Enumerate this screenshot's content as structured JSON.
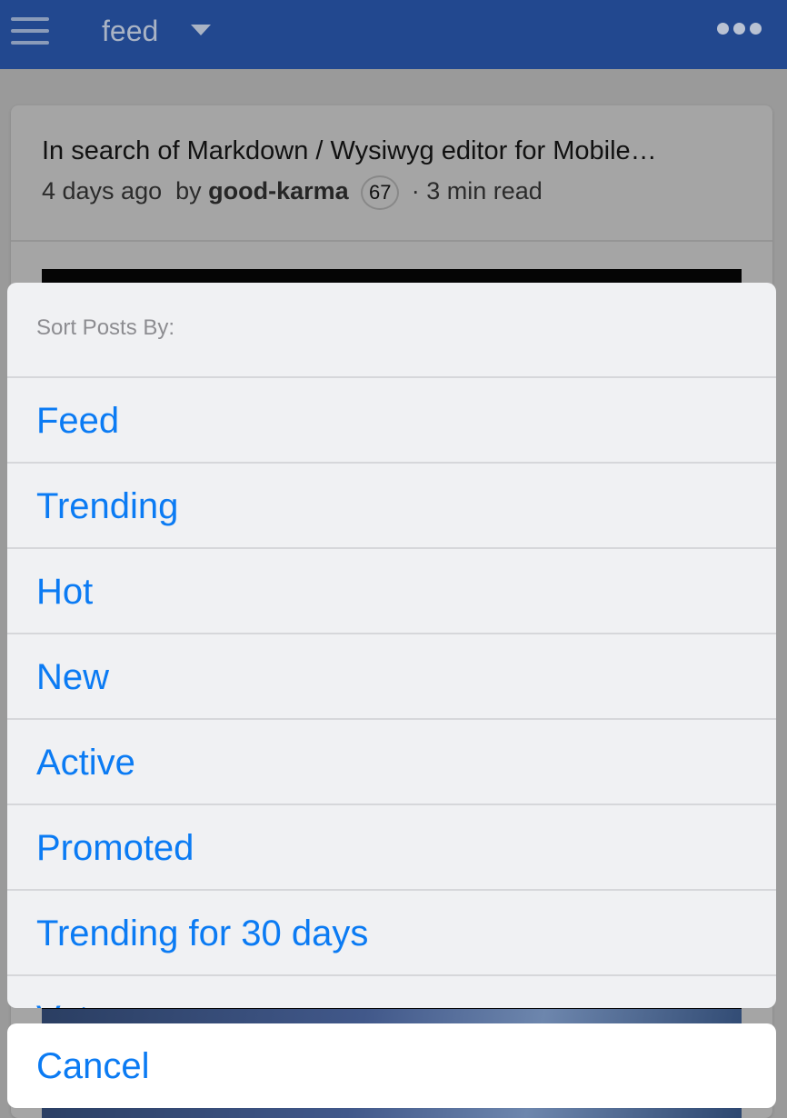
{
  "header": {
    "feed_label": "feed",
    "menu_icon": "hamburger-menu-icon",
    "dropdown_icon": "caret-down-icon",
    "more_icon": "more-dots-icon",
    "bar_color": "#22488f"
  },
  "post": {
    "title": "In search of Markdown / Wysiwyg editor for Mobile…",
    "age": "4 days ago",
    "by": "by",
    "author": "good-karma",
    "reputation": "67",
    "read_time": "· 3 min read"
  },
  "sort_sheet": {
    "title": "Sort Posts By:",
    "options": [
      {
        "label": "Feed"
      },
      {
        "label": "Trending"
      },
      {
        "label": "Hot"
      },
      {
        "label": "New"
      },
      {
        "label": "Active"
      },
      {
        "label": "Promoted"
      },
      {
        "label": "Trending for 30 days"
      },
      {
        "label": "Vot"
      }
    ],
    "cancel_label": "Cancel",
    "accent_color": "#0b7bf3"
  }
}
